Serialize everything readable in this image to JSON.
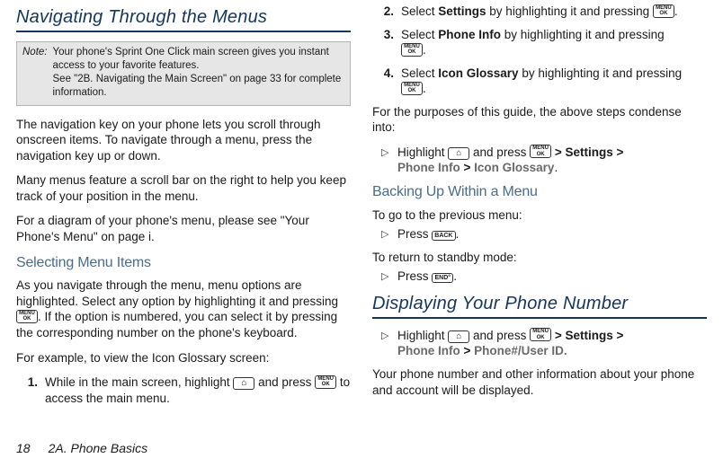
{
  "left": {
    "h1": "Navigating Through the Menus",
    "note_label": "Note:",
    "note_line1": "Your phone's Sprint One Click main screen gives you instant access to your favorite features.",
    "note_line2": "See \"2B. Navigating the Main Screen\" on page 33 for complete information.",
    "p1": "The navigation key on your phone lets you scroll through onscreen items. To navigate through a menu, press the navigation key up or down.",
    "p2": "Many menus feature a scroll bar on the right to help you keep track of your position in the menu.",
    "p3": "For a diagram of your phone's menu, please see \"Your Phone's Menu\" on page i.",
    "h2": "Selecting Menu Items",
    "p4_a": "As you navigate through the menu, menu options are highlighted. Select any option by highlighting it and pressing ",
    "p4_b": ". If the option is numbered, you can select it by pressing the corresponding number on the phone's keyboard.",
    "p5": "For example, to view the Icon Glossary screen:",
    "step1_a": "While in the main screen, highlight ",
    "step1_b": " and press ",
    "step1_c": " to access the main menu."
  },
  "right": {
    "step2_a": "Select ",
    "step2_label": "Settings",
    "step2_b": " by highlighting it and pressing ",
    "step2_c": ".",
    "step3_a": "Select ",
    "step3_label": "Phone Info",
    "step3_b": " by highlighting it and pressing ",
    "step3_c": ".",
    "step4_a": "Select ",
    "step4_label": "Icon Glossary",
    "step4_b": " by highlighting it and pressing ",
    "step4_c": ".",
    "condense": "For the purposes of this guide, the above steps condense into:",
    "bullet1_a": "Highlight ",
    "bullet1_b": " and press ",
    "bullet1_gt": " > ",
    "bullet1_settings": "Settings",
    "bullet1_phoneinfo": "Phone Info",
    "bullet1_iconglossary": "Icon Glossary",
    "bullet1_period": ".",
    "h2_back": "Backing Up Within a Menu",
    "prev_intro": "To go to the previous menu:",
    "press": "Press ",
    "period": ".",
    "standby_intro": "To return to standby mode:",
    "h1_display": "Displaying Your Phone Number",
    "bullet2_a": "Highlight ",
    "bullet2_b": " and press ",
    "bullet2_settings": "Settings",
    "bullet2_phoneinfo": "Phone Info",
    "bullet2_id": "Phone#/User ID.",
    "tail": "Your phone number and other information about your phone and account will be displayed."
  },
  "footer": {
    "page": "18",
    "title": "2A. Phone Basics"
  },
  "icons": {
    "menu_ok_top": "MENU",
    "menu_ok_bot": "OK",
    "home": "⌂",
    "back": "BACK",
    "end": "END°"
  },
  "nums": {
    "n1": "1.",
    "n2": "2.",
    "n3": "3.",
    "n4": "4."
  },
  "tri": "▷"
}
